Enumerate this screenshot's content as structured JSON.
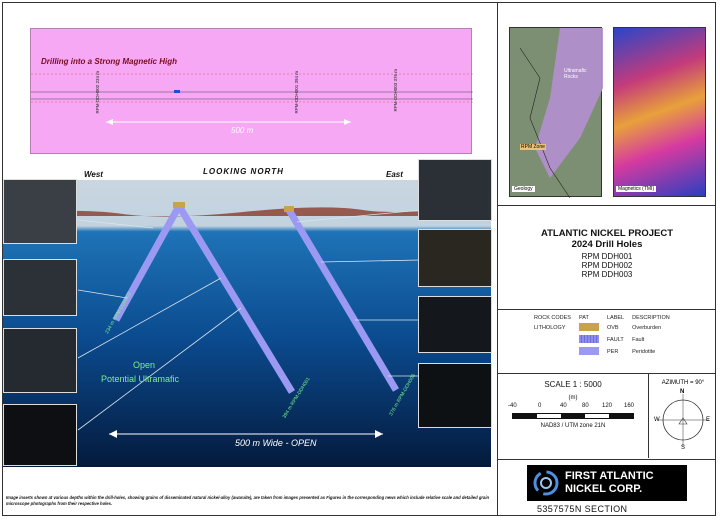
{
  "plan": {
    "title": "Drilling into a Strong Magnetic High",
    "holes": [
      {
        "label": "RPM-DDH002",
        "depth": "234 m"
      },
      {
        "label": "RPM-DDH001",
        "depth": "394 m"
      },
      {
        "label": "RPM-DDH003",
        "depth": "376 m"
      }
    ],
    "scale": "500 m"
  },
  "section": {
    "west": "West",
    "east": "East",
    "looking": "LOOKING NORTH",
    "open_label": "Open",
    "potential_label": "Potential Ultramafic",
    "wide_label": "500 m Wide - OPEN",
    "holes": [
      {
        "name": "RPM-DDH002",
        "depth": "234 m"
      },
      {
        "name": "RPM-DDH001",
        "depth": "394 m"
      },
      {
        "name": "RPM-DDH003",
        "depth": "376 m"
      }
    ]
  },
  "note": "Image inserts shown at various depths within the drill-holes, showing grains of disseminated natural nickel-alloy (awaruite), are taken from images presented as Figures in the corresponding news which include relative scale and detailed grain microscope photographs from their respective holes.",
  "maps": {
    "geology_caption": "Geology",
    "magnetics_caption": "Magnetics (TMI)",
    "geology_overlay_text": "Ultramafic Rocks",
    "geology_zone_label": "RPM Zone"
  },
  "title_block": {
    "project": "ATLANTIC NICKEL PROJECT",
    "subtitle": "2024 Drill Holes",
    "holes": [
      "RPM DDH001",
      "RPM DDH002",
      "RPM DDH003"
    ]
  },
  "legend": {
    "header_codes": "ROCK CODES",
    "header_lithology": "LITHOLOGY",
    "header_pat": "PAT",
    "header_label": "LABEL",
    "header_desc": "DESCRIPTION",
    "rows": [
      {
        "code": "OVB",
        "description": "Overburden",
        "color": "#c9a24a"
      },
      {
        "code": "FAULT",
        "description": "Fault",
        "color": "#8d8cf0"
      },
      {
        "code": "PER",
        "description": "Peridotite",
        "color": "#9b99f2"
      }
    ]
  },
  "scale": {
    "title": "SCALE 1 : 5000",
    "unit": "(m)",
    "ticks": [
      "-40",
      "0",
      "40",
      "80",
      "120",
      "160"
    ],
    "datum": "NAD83 / UTM zone 21N"
  },
  "azimuth": {
    "label": "AZIMUTH = 90°",
    "n": "N",
    "s": "S",
    "e": "E",
    "w": "W"
  },
  "logo": {
    "line1": "FIRST ATLANTIC",
    "line2": "NICKEL CORP."
  },
  "section_number": "5357575N  SECTION"
}
